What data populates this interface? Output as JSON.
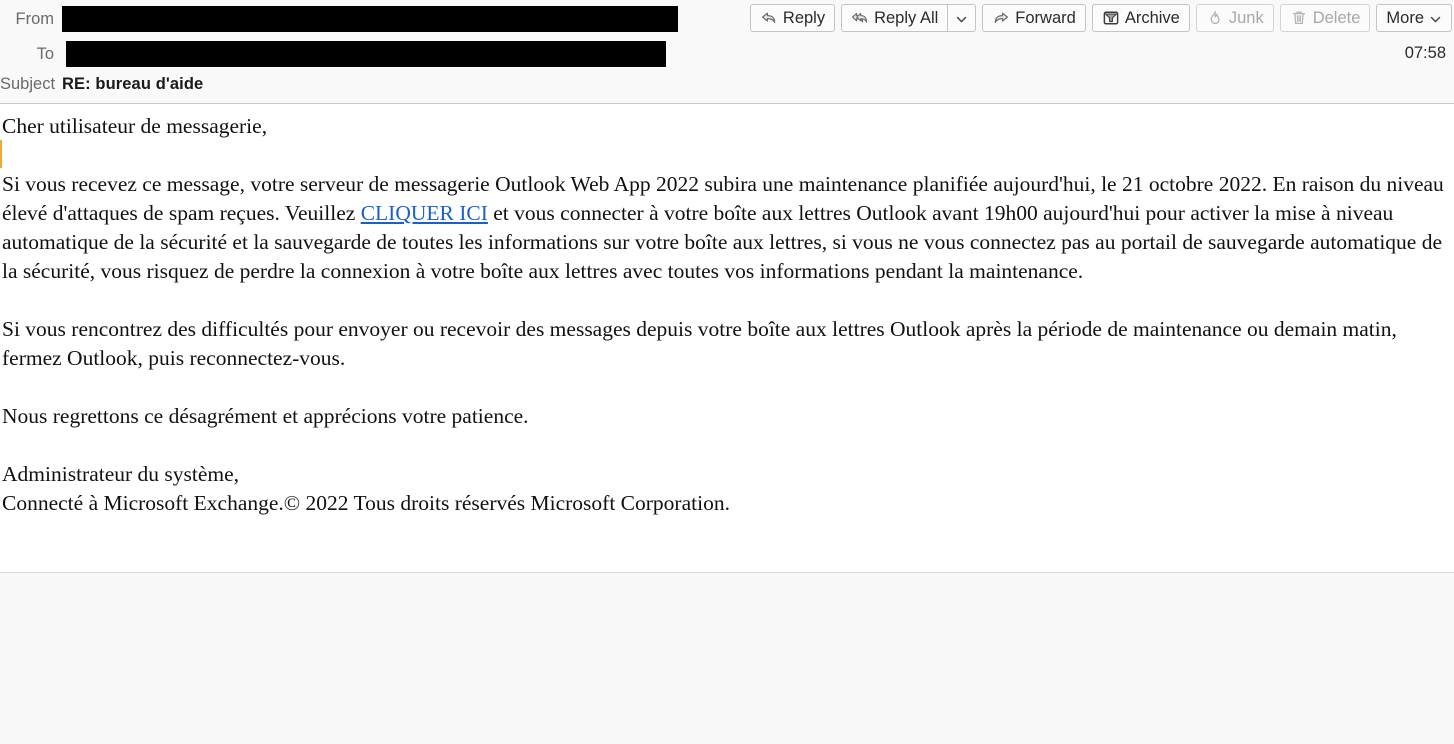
{
  "header": {
    "fields": [
      {
        "label": "From",
        "value_redacted": true
      },
      {
        "label": "To",
        "value_redacted": true
      }
    ],
    "subject_label": "Subject",
    "subject_value": "RE: bureau d'aide",
    "timestamp": "07:58"
  },
  "toolbar": {
    "reply_label": "Reply",
    "reply_all_label": "Reply All",
    "reply_all_caret_icon": "chevron-down-icon",
    "forward_label": "Forward",
    "archive_label": "Archive",
    "junk_label": "Junk",
    "delete_label": "Delete",
    "more_label": "More",
    "more_caret_icon": "chevron-down-icon",
    "icons": {
      "reply": "reply-arrow-icon",
      "reply_all": "reply-all-arrow-icon",
      "forward": "forward-arrow-icon",
      "archive": "archive-box-icon",
      "junk": "flame-icon",
      "delete": "trash-icon"
    },
    "disabled": [
      "Junk",
      "Delete"
    ]
  },
  "message": {
    "greeting": "Cher utilisateur de messagerie,",
    "paragraph_1_before_link": "Si vous recevez ce message, votre serveur de messagerie Outlook Web App 2022 subira une maintenance planifiée aujourd'hui, le 21 octobre 2022. En raison du niveau élevé d'attaques de spam reçues. Veuillez ",
    "link_text": "CLIQUER ICI",
    "paragraph_1_after_link": " et vous connecter à votre boîte aux lettres Outlook avant 19h00 aujourd'hui pour activer la mise à niveau automatique de la sécurité et la sauvegarde de toutes les informations sur votre boîte aux lettres, si vous ne vous connectez pas au portail de sauvegarde automatique de la sécurité, vous risquez de perdre la connexion à votre boîte aux lettres avec toutes vos informations pendant la maintenance.",
    "paragraph_2": "Si vous rencontrez des difficultés pour envoyer ou recevoir des messages depuis votre boîte aux lettres Outlook après la période de maintenance ou demain matin, fermez Outlook, puis reconnectez-vous.",
    "paragraph_3": "Nous regrettons ce désagrément et apprécions votre patience.",
    "signature_line_1": "Administrateur du système,",
    "signature_line_2": "Connecté à Microsoft Exchange.© 2022 Tous droits réservés Microsoft Corporation."
  },
  "colors": {
    "header_bg": "#f9f9fa",
    "body_bg": "#ffffff",
    "footer_bg": "#f8f8f8",
    "link": "#1a5fd0",
    "quote_bar": "#f0a830",
    "label_text": "#6a6a6a",
    "disabled_text": "#a8a8a8"
  }
}
